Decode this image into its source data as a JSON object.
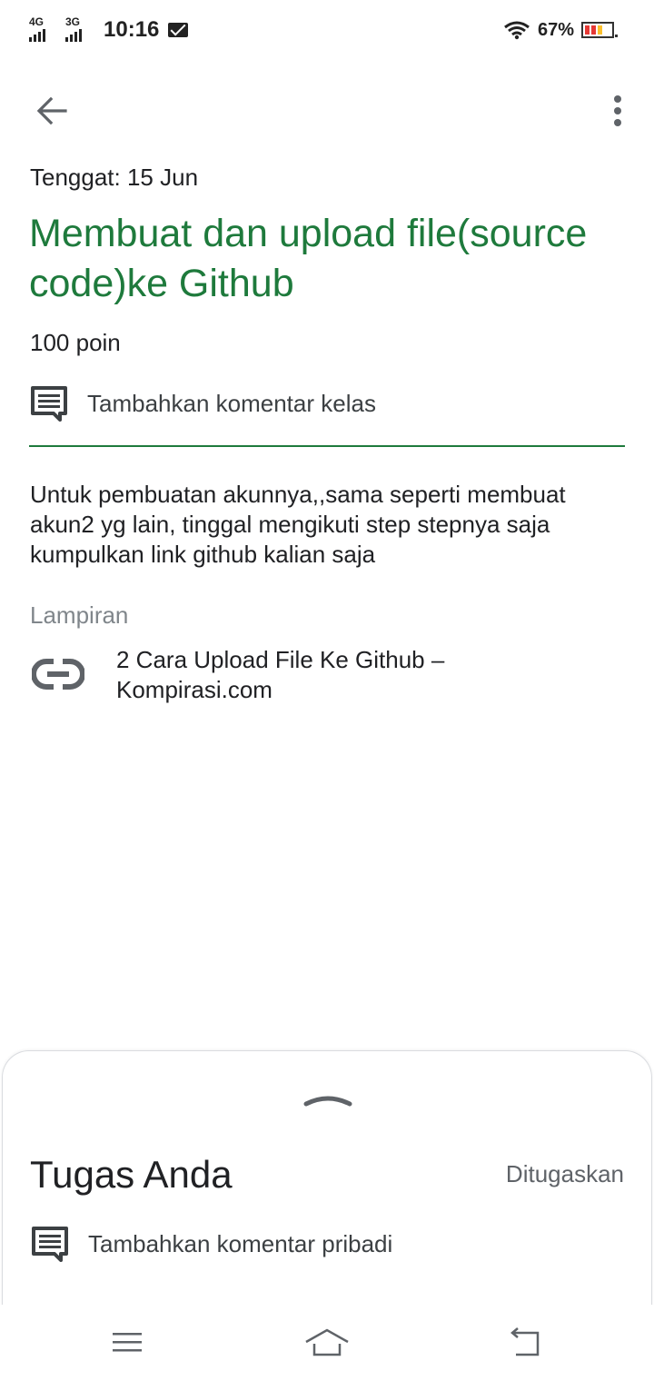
{
  "status_bar": {
    "network_1": "4G",
    "network_2": "3G",
    "time": "10:16",
    "battery_percent": "67%",
    "battery_level": 0.67,
    "icons": [
      "signal-icon",
      "mail-icon",
      "wifi-icon",
      "battery-icon"
    ]
  },
  "app_bar": {
    "back_icon": "arrow-back-icon",
    "more_icon": "more-vert-icon"
  },
  "assignment": {
    "due": "Tenggat: 15 Jun",
    "title": "Membuat dan upload file(source code)ke Github",
    "points": "100 poin",
    "class_comment_label": "Tambahkan komentar kelas",
    "description_lines": [
      "Untuk pembuatan akunnya,,sama seperti membuat",
      "akun2 yg lain, tinggal mengikuti step stepnya saja",
      "kumpulkan link github kalian saja"
    ],
    "attachments_heading": "Lampiran",
    "attachment": {
      "title": "2 Cara Upload File Ke Github – Kompirasi.com",
      "icon": "link-icon"
    }
  },
  "work_sheet": {
    "title": "Tugas Anda",
    "status": "Ditugaskan",
    "private_comment_label": "Tambahkan komentar pribadi"
  },
  "nav_bar": {
    "icons": [
      "menu-icon",
      "home-icon",
      "back-icon"
    ]
  },
  "colors": {
    "accent_green": "#1e7a3c",
    "text_primary": "#202124",
    "text_secondary": "#5f6368",
    "text_muted": "#80868b"
  }
}
